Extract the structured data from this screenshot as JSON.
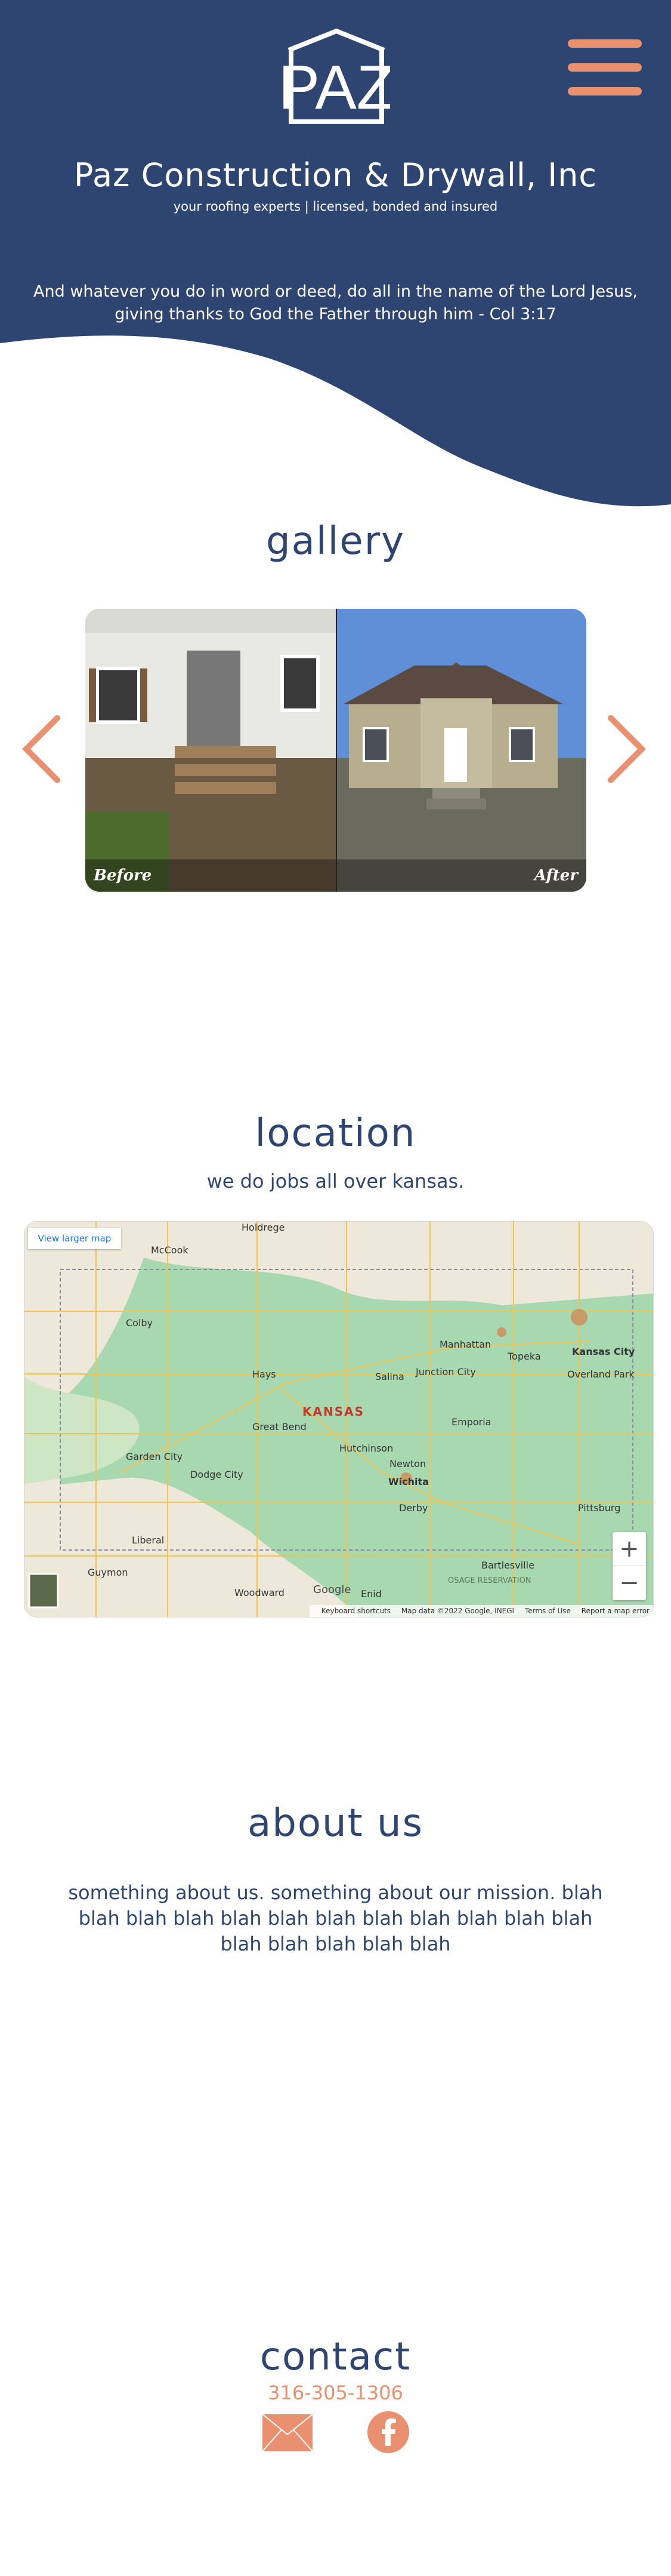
{
  "header": {
    "logo_text": "PAZ",
    "title": "Paz Construction & Drywall, Inc",
    "tagline": "your roofing experts | licensed, bonded and insured",
    "verse": "And whatever you do in word or deed, do all in the name of the Lord Jesus, giving thanks to God the Father through him - Col 3:17",
    "menu_icon": "hamburger-icon"
  },
  "gallery": {
    "title": "gallery",
    "before_label": "Before",
    "after_label": "After",
    "prev_icon": "chevron-left-icon",
    "next_icon": "chevron-right-icon"
  },
  "location": {
    "title": "location",
    "subtitle": "we do  jobs all over kansas.",
    "map": {
      "view_larger": "View larger map",
      "zoom_in": "+",
      "zoom_out": "−",
      "state_label": "KANSAS",
      "cities": [
        "Holdrege",
        "McCook",
        "Colby",
        "Hays",
        "Manhattan",
        "Topeka",
        "Kansas City",
        "Overland Park",
        "Junction City",
        "Salina",
        "Great Bend",
        "Emporia",
        "Hutchinson",
        "Newton",
        "Wichita",
        "Garden City",
        "Dodge City",
        "Liberal",
        "Guymon",
        "Woodward",
        "Enid",
        "Derby",
        "Pittsburg",
        "Bartlesville",
        "OSAGE RESERVATION"
      ],
      "footer": {
        "shortcuts": "Keyboard shortcuts",
        "data": "Map data ©2022 Google, INEGI",
        "terms": "Terms of Use",
        "report": "Report a map error"
      },
      "google": "Google"
    }
  },
  "about": {
    "title": "about us",
    "text": "something about us. something about our mission. blah blah blah blah blah blah blah blah blah blah blah blah blah blah blah blah blah"
  },
  "contact": {
    "title": "contact",
    "phone": "316-305-1306",
    "email_icon": "envelope-icon",
    "facebook_icon": "facebook-icon"
  },
  "colors": {
    "navy": "#2d4570",
    "accent": "#e8906f",
    "white": "#ffffff"
  }
}
